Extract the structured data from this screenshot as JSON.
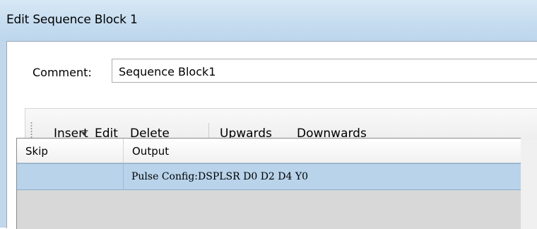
{
  "window": {
    "title": "Edit Sequence Block 1"
  },
  "comment": {
    "label": "Comment:",
    "value": "Sequence Block1"
  },
  "toolbar": {
    "insert_label": "Insert",
    "edit_label": "Edit",
    "delete_label": "Delete",
    "upwards_label": "Upwards",
    "downwards_label": "Downwards"
  },
  "grid": {
    "columns": [
      "Skip",
      "Output"
    ],
    "rows": [
      {
        "skip": "",
        "output": "Pulse Config:DSPLSR D0 D2 D4 Y0",
        "selected": true
      }
    ]
  },
  "colors": {
    "titlebar": "#c6ddf0",
    "selected_row": "#b8d3ea",
    "grid_background": "#d8d8d8"
  }
}
